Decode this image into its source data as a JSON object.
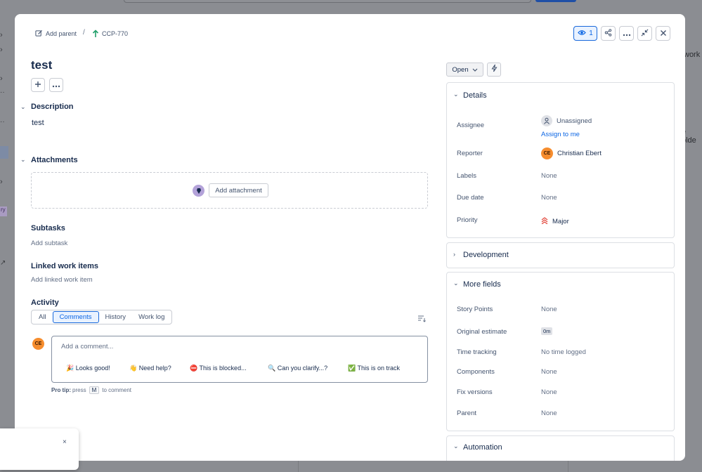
{
  "background": {
    "right_text_1": "work i",
    "right_text_2": "e olde",
    "purple_tag": "ry"
  },
  "breadcrumb": {
    "add_parent": "Add parent",
    "separator": "/",
    "issue_key": "CCP-770"
  },
  "header": {
    "watch_count": "1"
  },
  "issue": {
    "title": "test"
  },
  "description": {
    "title": "Description",
    "text": "test"
  },
  "attachments": {
    "title": "Attachments",
    "add_label": "Add attachment"
  },
  "subtasks": {
    "title": "Subtasks",
    "add_label": "Add subtask"
  },
  "linked": {
    "title": "Linked work items",
    "add_label": "Add linked work item"
  },
  "activity": {
    "title": "Activity",
    "tabs": [
      "All",
      "Comments",
      "History",
      "Work log"
    ],
    "active_tab": "Comments",
    "user_initials": "CE",
    "comment_placeholder": "Add a comment...",
    "quick_replies": [
      "🎉 Looks good!",
      "👋 Need help?",
      "⛔ This is blocked...",
      "🔍 Can you clarify...?",
      "✅ This is on track"
    ],
    "protip_bold": "Pro tip:",
    "protip_press": "press",
    "protip_key": "M",
    "protip_suffix": "to comment"
  },
  "status": {
    "label": "Open"
  },
  "details": {
    "title": "Details",
    "assignee_label": "Assignee",
    "assignee_value": "Unassigned",
    "assign_to_me": "Assign to me",
    "reporter_label": "Reporter",
    "reporter_initials": "CE",
    "reporter_value": "Christian Ebert",
    "labels_label": "Labels",
    "labels_value": "None",
    "due_label": "Due date",
    "due_value": "None",
    "priority_label": "Priority",
    "priority_value": "Major"
  },
  "development": {
    "title": "Development"
  },
  "more_fields": {
    "title": "More fields",
    "story_points_label": "Story Points",
    "story_points_value": "None",
    "estimate_label": "Original estimate",
    "estimate_value": "0m",
    "tracking_label": "Time tracking",
    "tracking_value": "No time logged",
    "components_label": "Components",
    "components_value": "None",
    "fix_label": "Fix versions",
    "fix_value": "None",
    "parent_label": "Parent",
    "parent_value": "None"
  },
  "automation": {
    "title": "Automation"
  },
  "toast": {
    "close": "×"
  },
  "colors": {
    "accent": "#0c66e4",
    "avatar": "#f68d2e",
    "priority_major": "#e2483d",
    "key_arrow": "#22a06b"
  }
}
